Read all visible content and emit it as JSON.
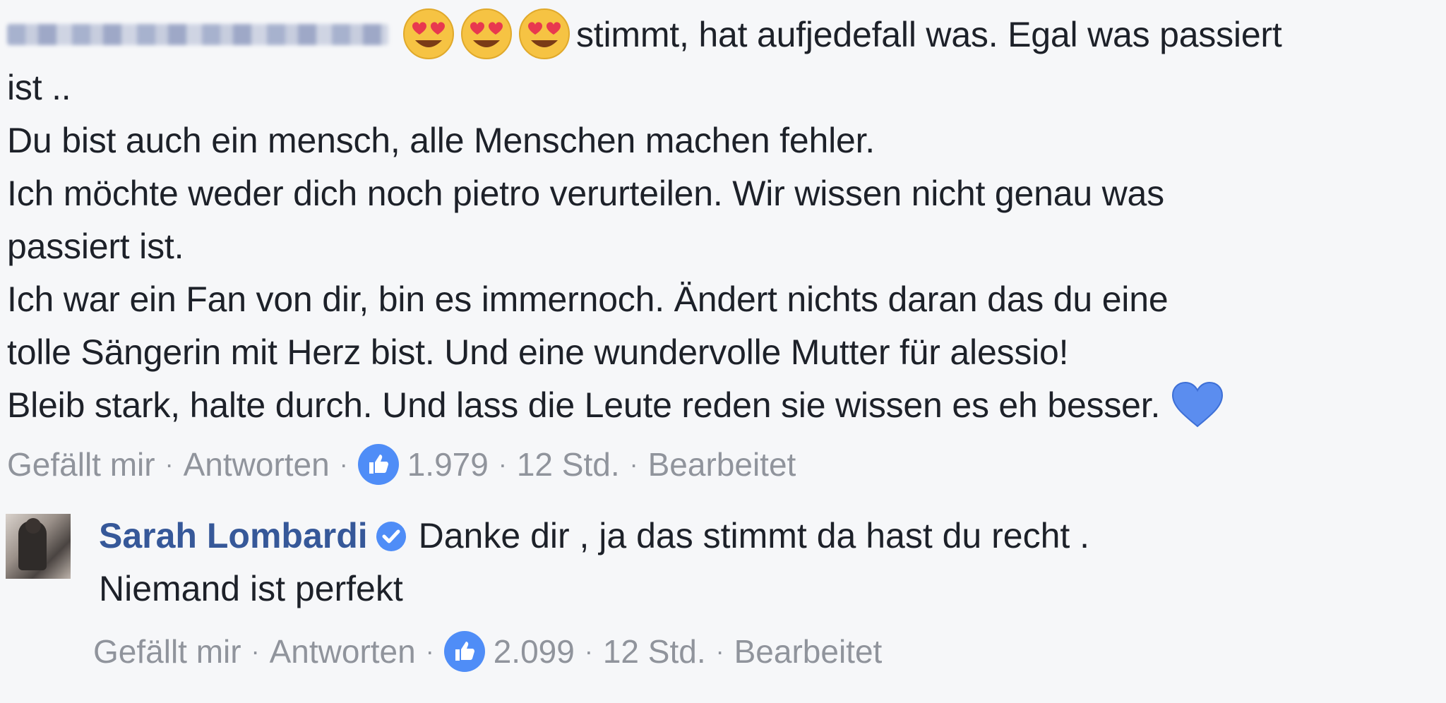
{
  "comment": {
    "author_blurred": true,
    "emoji": [
      "heart-eyes-emoji",
      "heart-eyes-emoji",
      "heart-eyes-emoji"
    ],
    "lines": [
      "stimmt, hat aufjedefall was. Egal was passiert",
      "ist ..",
      "Du bist auch ein mensch, alle Menschen machen fehler.",
      "Ich möchte weder dich noch pietro verurteilen. Wir wissen nicht genau was",
      "passiert ist.",
      "Ich war ein Fan von dir, bin es immernoch. Ändert nichts daran das du eine",
      "tolle Sängerin mit Herz bist. Und eine wundervolle Mutter für alessio!",
      "Bleib stark, halte durch. Und lass die Leute reden sie wissen es eh besser."
    ],
    "trailing_icon": "blue-heart-emoji",
    "meta": {
      "like_label": "Gefällt mir",
      "reply_label": "Antworten",
      "like_count": "1.979",
      "time": "12 Std.",
      "edited": "Bearbeitet",
      "separator": "·"
    }
  },
  "reply": {
    "author": "Sarah Lombardi",
    "verified_icon": "verified-badge-icon",
    "line1": "Danke dir , ja das stimmt da hast du recht .",
    "line2": "Niemand ist perfekt",
    "meta": {
      "like_label": "Gefällt mir",
      "reply_label": "Antworten",
      "like_count": "2.099",
      "time": "12 Std.",
      "edited": "Bearbeitet",
      "separator": "·"
    }
  },
  "colors": {
    "background": "#f6f7f9",
    "text": "#1d2129",
    "meta": "#90949c",
    "author": "#365899",
    "like_blue": "#4f8df7",
    "heart_blue": "#5b8def"
  }
}
